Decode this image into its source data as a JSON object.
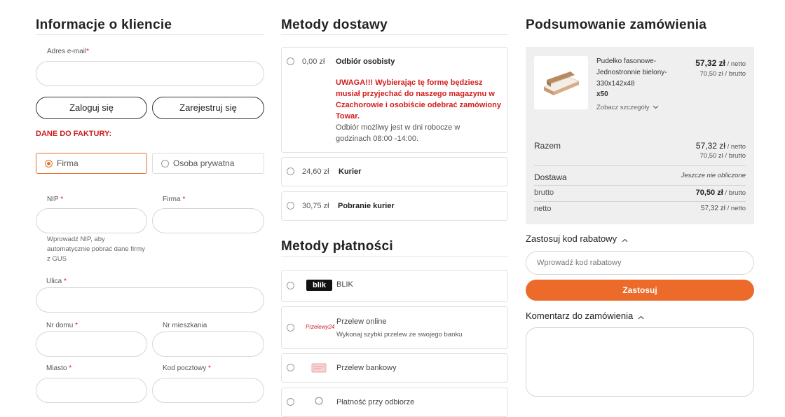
{
  "customer": {
    "title": "Informacje o kliencie",
    "email_label": "Adres e-mail",
    "login_button": "Zaloguj się",
    "register_button": "Zarejestruj się",
    "invoice_heading": "DANE DO FAKTURY:",
    "type_company": "Firma",
    "type_private": "Osoba prywatna",
    "nip_label": "NIP",
    "company_label": "Firma",
    "nip_hint": "Wprowadź NIP, aby automatycznie pobrać dane firmy z GUS",
    "street_label": "Ulica",
    "house_label": "Nr domu",
    "flat_label": "Nr mieszkania",
    "city_label": "Miasto",
    "postcode_label": "Kod pocztowy",
    "required_mark": "*"
  },
  "delivery": {
    "title": "Metody dostawy",
    "methods": [
      {
        "price": "0,00 zł",
        "name": "Odbiór osobisty",
        "warning": "UWAGA!!! Wybierając tę formę będziesz musiał przyjechać do naszego magazynu w Czachorowie i osobiście odebrać zamówiony Towar.",
        "note": "Odbiór możliwy jest w dni robocze w godzinach 08:00 -14:00."
      },
      {
        "price": "24,60 zł",
        "name": "Kurier"
      },
      {
        "price": "30,75 zł",
        "name": "Pobranie kurier"
      }
    ]
  },
  "payment": {
    "title": "Metody płatności",
    "methods": [
      {
        "name": "BLIK",
        "logo": "blik",
        "icon": "blik-logo"
      },
      {
        "name": "Przelew online",
        "sub": "Wykonaj szybki przelew ze swojego banku",
        "logo": "Przelewy24",
        "icon": "przelewy24-logo"
      },
      {
        "name": "Przelew bankowy",
        "icon": "bank-transfer-icon"
      },
      {
        "name": "Płatność przy odbiorze",
        "icon": "cash-on-delivery-icon"
      }
    ]
  },
  "summary": {
    "title": "Podsumowanie zamówienia",
    "product": {
      "name_lines": [
        "Pudełko fasonowe-",
        "Jednostronnie bielony-",
        "330x142x48",
        "x50"
      ],
      "price_net": "57,32 zł",
      "price_net_suffix": "/ netto",
      "price_gross": "70,50 zł",
      "price_gross_suffix": "/ brutto",
      "details_link": "Zobacz szczegóły"
    },
    "total_label": "Razem",
    "total_net": "57,32 zł",
    "total_net_suffix": "/ netto",
    "total_gross": "70,50 zł",
    "total_gross_suffix": "/ brutto",
    "shipping_label": "Dostawa",
    "shipping_value": "Jeszcze nie obliczone",
    "gross_label": "brutto",
    "gross_value": "70,50 zł",
    "gross_suffix": "/ brutto",
    "net_label": "netto",
    "net_value": "57,32 zł",
    "net_suffix": "/ netto"
  },
  "discount": {
    "title": "Zastosuj kod rabatowy",
    "placeholder": "Wprowadź kod rabatowy",
    "apply_button": "Zastosuj"
  },
  "comment": {
    "title": "Komentarz do zamówienia"
  },
  "colors": {
    "accent": "#ec6a2a",
    "warning": "#d21c1c",
    "summary_bg": "#efefef"
  }
}
